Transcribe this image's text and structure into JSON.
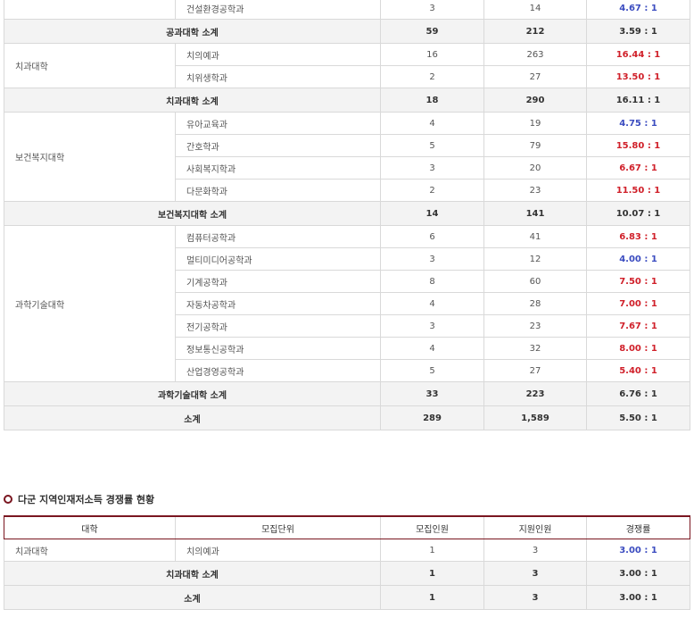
{
  "table1": {
    "rows": [
      {
        "type": "row",
        "college": "",
        "dept": "건설환경공학과",
        "quota": "3",
        "applicants": "14",
        "ratio": "4.67 : 1",
        "ratio_color": "blue"
      },
      {
        "type": "sub",
        "label": "공과대학 소계",
        "quota": "59",
        "applicants": "212",
        "ratio": "3.59 : 1",
        "ratio_color": "blue"
      },
      {
        "type": "row",
        "college": "치과대학",
        "rowspan": 2,
        "dept": "치의예과",
        "quota": "16",
        "applicants": "263",
        "ratio": "16.44 : 1",
        "ratio_color": "red"
      },
      {
        "type": "row",
        "dept": "치위생학과",
        "quota": "2",
        "applicants": "27",
        "ratio": "13.50 : 1",
        "ratio_color": "red"
      },
      {
        "type": "sub",
        "label": "치과대학 소계",
        "quota": "18",
        "applicants": "290",
        "ratio": "16.11 : 1",
        "ratio_color": "red"
      },
      {
        "type": "row",
        "college": "보건복지대학",
        "rowspan": 4,
        "dept": "유아교육과",
        "quota": "4",
        "applicants": "19",
        "ratio": "4.75 : 1",
        "ratio_color": "blue"
      },
      {
        "type": "row",
        "dept": "간호학과",
        "quota": "5",
        "applicants": "79",
        "ratio": "15.80 : 1",
        "ratio_color": "red"
      },
      {
        "type": "row",
        "dept": "사회복지학과",
        "quota": "3",
        "applicants": "20",
        "ratio": "6.67 : 1",
        "ratio_color": "red"
      },
      {
        "type": "row",
        "dept": "다문화학과",
        "quota": "2",
        "applicants": "23",
        "ratio": "11.50 : 1",
        "ratio_color": "red"
      },
      {
        "type": "sub",
        "label": "보건복지대학 소계",
        "quota": "14",
        "applicants": "141",
        "ratio": "10.07 : 1",
        "ratio_color": "red"
      },
      {
        "type": "row",
        "college": "과학기술대학",
        "rowspan": 7,
        "dept": "컴퓨터공학과",
        "quota": "6",
        "applicants": "41",
        "ratio": "6.83 : 1",
        "ratio_color": "red"
      },
      {
        "type": "row",
        "dept": "멀티미디어공학과",
        "quota": "3",
        "applicants": "12",
        "ratio": "4.00 : 1",
        "ratio_color": "blue"
      },
      {
        "type": "row",
        "dept": "기계공학과",
        "quota": "8",
        "applicants": "60",
        "ratio": "7.50 : 1",
        "ratio_color": "red"
      },
      {
        "type": "row",
        "dept": "자동차공학과",
        "quota": "4",
        "applicants": "28",
        "ratio": "7.00 : 1",
        "ratio_color": "red"
      },
      {
        "type": "row",
        "dept": "전기공학과",
        "quota": "3",
        "applicants": "23",
        "ratio": "7.67 : 1",
        "ratio_color": "red"
      },
      {
        "type": "row",
        "dept": "정보통신공학과",
        "quota": "4",
        "applicants": "32",
        "ratio": "8.00 : 1",
        "ratio_color": "red"
      },
      {
        "type": "row",
        "dept": "산업경영공학과",
        "quota": "5",
        "applicants": "27",
        "ratio": "5.40 : 1",
        "ratio_color": "red"
      },
      {
        "type": "sub",
        "label": "과학기술대학 소계",
        "quota": "33",
        "applicants": "223",
        "ratio": "6.76 : 1",
        "ratio_color": "red"
      },
      {
        "type": "sub",
        "label": "소계",
        "quota": "289",
        "applicants": "1,589",
        "ratio": "5.50 : 1",
        "ratio_color": "red"
      }
    ]
  },
  "section2": {
    "title": "다군 지역인재저소득 경쟁률 현황",
    "headers": [
      "대학",
      "모집단위",
      "모집인원",
      "지원인원",
      "경쟁률"
    ],
    "rows": [
      {
        "type": "row",
        "college": "치과대학",
        "dept": "치의예과",
        "quota": "1",
        "applicants": "3",
        "ratio": "3.00 : 1",
        "ratio_color": "blue"
      },
      {
        "type": "sub",
        "label": "치과대학 소계",
        "quota": "1",
        "applicants": "3",
        "ratio": "3.00 : 1",
        "ratio_color": "blue"
      },
      {
        "type": "sub",
        "label": "소계",
        "quota": "1",
        "applicants": "3",
        "ratio": "3.00 : 1",
        "ratio_color": "blue"
      }
    ]
  },
  "colors": {
    "blue": "#3b4cc0",
    "red": "#d0202a",
    "accent": "#7a1620"
  }
}
